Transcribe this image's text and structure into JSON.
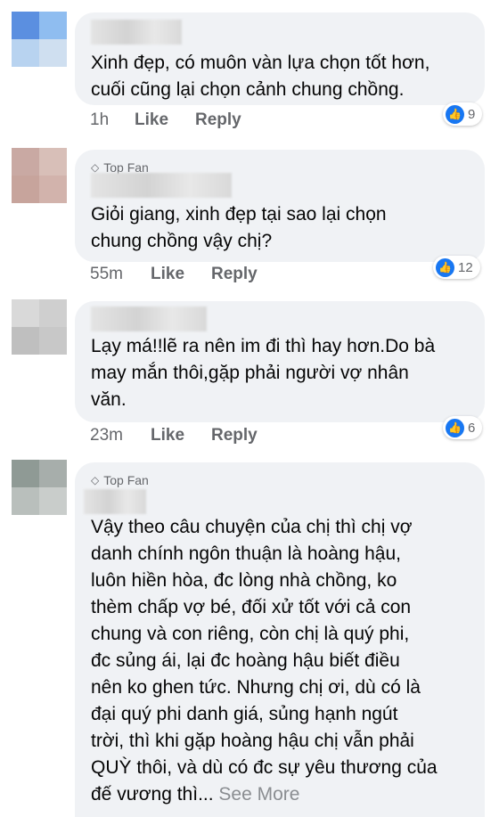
{
  "comments": [
    {
      "text_lines": [
        "Xinh đẹp, có muôn vàn lựa chọn tốt hơn,",
        "cuối cũng lại chọn cảnh chung chồng."
      ],
      "time": "1h",
      "like": "Like",
      "reply": "Reply",
      "reactions": "9",
      "avatar_colors": [
        "#5b8fe0",
        "#8fbdf0",
        "#b8d3f0",
        "#cfdff0"
      ]
    },
    {
      "badge": "Top Fan",
      "text_lines": [
        "Giỏi giang, xinh đẹp tại sao lại chọn",
        "chung chồng vậy chị?"
      ],
      "time": "55m",
      "like": "Like",
      "reply": "Reply",
      "reactions": "12",
      "avatar_colors": [
        "#c9a9a3",
        "#d8bfb8",
        "#c7a49c",
        "#d2b3ac"
      ]
    },
    {
      "text_lines": [
        "Lạy má!!lẽ ra nên im đi thì hay hơn.Do bà",
        "may mắn thôi,gặp phải người vợ nhân",
        "văn."
      ],
      "time": "23m",
      "like": "Like",
      "reply": "Reply",
      "reactions": "6",
      "avatar_colors": [
        "#d9d9d9",
        "#cfcfcf",
        "#bfbfbf",
        "#c8c8c8"
      ]
    },
    {
      "badge": "Top Fan",
      "text_lines": [
        "Vậy theo câu chuyện của chị thì chị vợ",
        "danh chính ngôn thuận là hoàng hậu,",
        "luôn hiền hòa, đc lòng nhà chồng, ko",
        "thèm chấp vợ bé, đối xử tốt với cả con",
        "chung và con riêng, còn chị là quý phi,",
        "đc sủng ái, lại đc hoàng hậu biết điều",
        "nên ko ghen tức. Nhưng chị ơi, dù có là",
        "đại quý phi danh giá, sủng hạnh ngút",
        "trời, thì khi gặp hoàng hậu chị vẫn phải",
        "QUỲ thôi, và dù có đc sự yêu thương của"
      ],
      "last_line": "đế vương thì...",
      "see_more": "See More",
      "avatar_colors": [
        "#8f9a95",
        "#a7aeab",
        "#b9bfbc",
        "#c9cdcb"
      ]
    }
  ],
  "colors": {
    "bubble": "#f0f2f5",
    "meta": "#65676b",
    "like_blue": "#1877f2"
  }
}
